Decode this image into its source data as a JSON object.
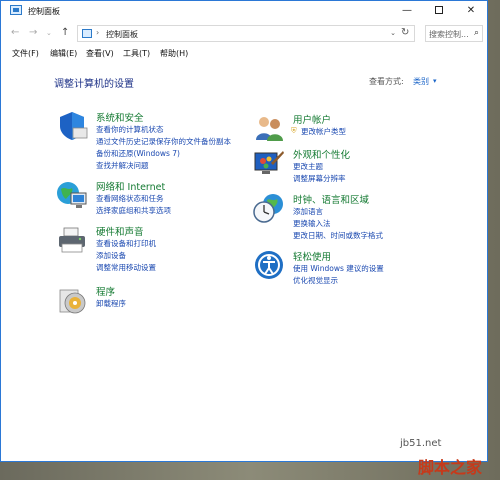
{
  "window": {
    "title": "控制面板",
    "minimize": "—",
    "close": "✕"
  },
  "address": {
    "path": "控制面板",
    "search_placeholder": "搜索控制..."
  },
  "menu": [
    {
      "label": "文件(F)"
    },
    {
      "label": "编辑(E)"
    },
    {
      "label": "查看(V)"
    },
    {
      "label": "工具(T)"
    },
    {
      "label": "帮助(H)"
    }
  ],
  "main": {
    "heading": "调整计算机的设置",
    "view_by_label": "查看方式:",
    "view_by_value": "类别"
  },
  "categories": [
    {
      "title": "系统和安全",
      "icon": "shield-icon",
      "links": [
        "查看你的计算机状态",
        "通过文件历史记录保存你的文件备份副本",
        "备份和还原(Windows 7)",
        "查找并解决问题"
      ]
    },
    {
      "title": "网络和 Internet",
      "icon": "network-globe-icon",
      "links": [
        "查看网络状态和任务",
        "选择家庭组和共享选项"
      ]
    },
    {
      "title": "硬件和声音",
      "icon": "printer-icon",
      "links": [
        "查看设备和打印机",
        "添加设备",
        "调整常用移动设置"
      ]
    },
    {
      "title": "程序",
      "icon": "programs-disc-icon",
      "links": [
        "卸载程序"
      ]
    },
    {
      "title": "用户帐户",
      "icon": "users-icon",
      "links": [
        "更改帐户类型"
      ]
    },
    {
      "title": "外观和个性化",
      "icon": "appearance-icon",
      "links": [
        "更改主题",
        "调整屏幕分辨率"
      ]
    },
    {
      "title": "时钟、语言和区域",
      "icon": "clock-globe-icon",
      "links": [
        "添加语言",
        "更换输入法",
        "更改日期、时间或数字格式"
      ]
    },
    {
      "title": "轻松使用",
      "icon": "ease-of-access-icon",
      "links": [
        "使用 Windows 建议的设置",
        "优化视觉显示"
      ]
    }
  ],
  "watermark": {
    "site": "jb51.net",
    "brand": "脚本之家"
  }
}
